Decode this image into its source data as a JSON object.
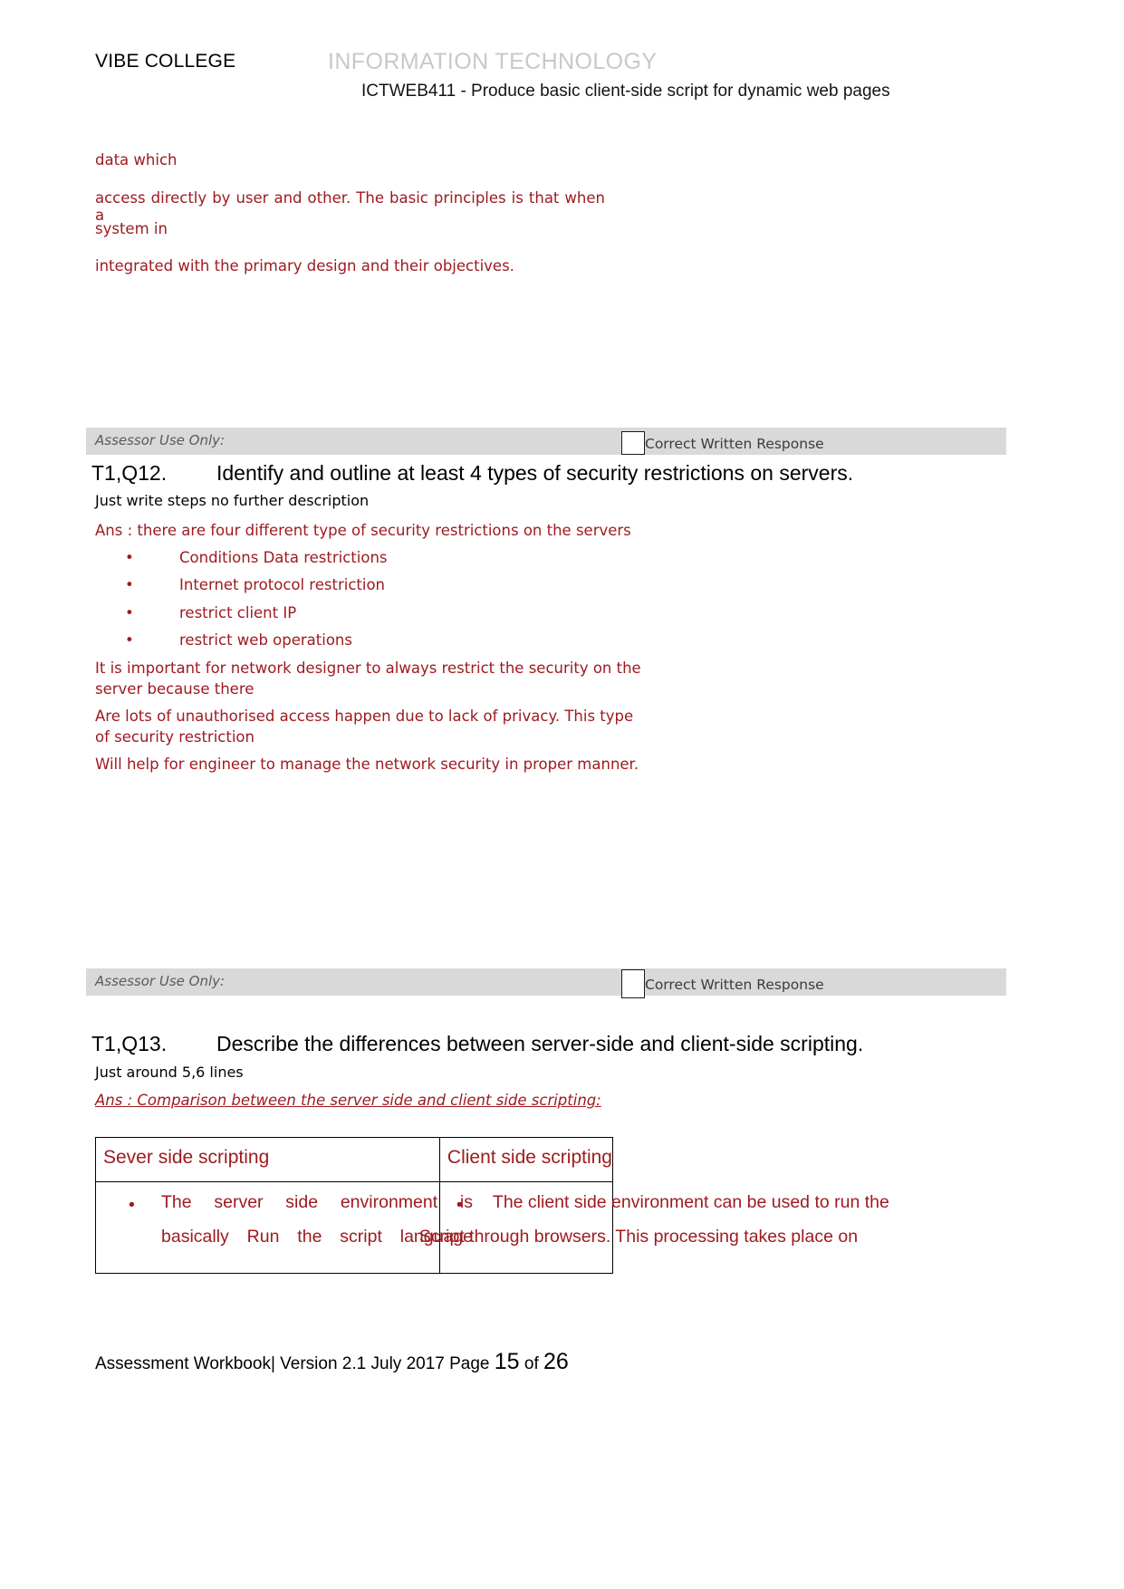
{
  "header": {
    "college": "VIBE COLLEGE",
    "department": "INFORMATION TECHNOLOGY",
    "unit": "ICTWEB411 - Produce basic client-side script for dynamic web pages",
    "department_color": "#c8c8c8"
  },
  "answer_color": "#9e1b20",
  "top_answer": {
    "line1": "data which",
    "line2": "access directly by user and other. The basic principles is that when a",
    "line3": "system in",
    "line4": "integrated with the primary design and their objectives."
  },
  "assessor_bar_1": {
    "label": "Assessor Use Only:",
    "checkbox_label": "Correct Written Response",
    "checkbox_checked": false
  },
  "q12": {
    "tag": "T1,Q12.",
    "title": "Identify and outline at least 4 types of security restrictions on servers.",
    "instruction": "Just write steps no further description",
    "answer_intro": "Ans : there are four different type of security restrictions on the servers",
    "bullets": [
      "Conditions Data restrictions",
      "Internet protocol restriction",
      "restrict client IP",
      "restrict web operations"
    ],
    "paragraphs": [
      [
        "It is important for network designer to always restrict the security on the",
        "server because there"
      ],
      [
        "Are lots of unauthorised access happen due to lack of privacy. This type",
        "of security restriction"
      ],
      [
        "Will help for engineer to manage the network security in proper manner."
      ]
    ]
  },
  "assessor_bar_2": {
    "label": "Assessor Use Only:",
    "checkbox_label": "Correct Written Response",
    "checkbox_checked": false
  },
  "q13": {
    "tag": "T1,Q13.",
    "title": "Describe the differences between server-side and client-side scripting.",
    "instruction": "Just around 5,6 lines",
    "answer_intro": "Ans : Comparison between the server side and client side scripting:",
    "table": {
      "headers": [
        "Sever side scripting",
        "Client side scripting"
      ],
      "rows": [
        {
          "server": [
            "The server side environment is",
            "basically Run the script language"
          ],
          "client": [
            "The client side environment can be used to run the",
            "Script through browsers. This processing takes place on"
          ]
        }
      ]
    }
  },
  "footer": {
    "prefix": "Assessment Workbook| Version 2.1 July 2017 Page ",
    "page_number": "15",
    "middle": " of ",
    "total_pages": "26"
  }
}
